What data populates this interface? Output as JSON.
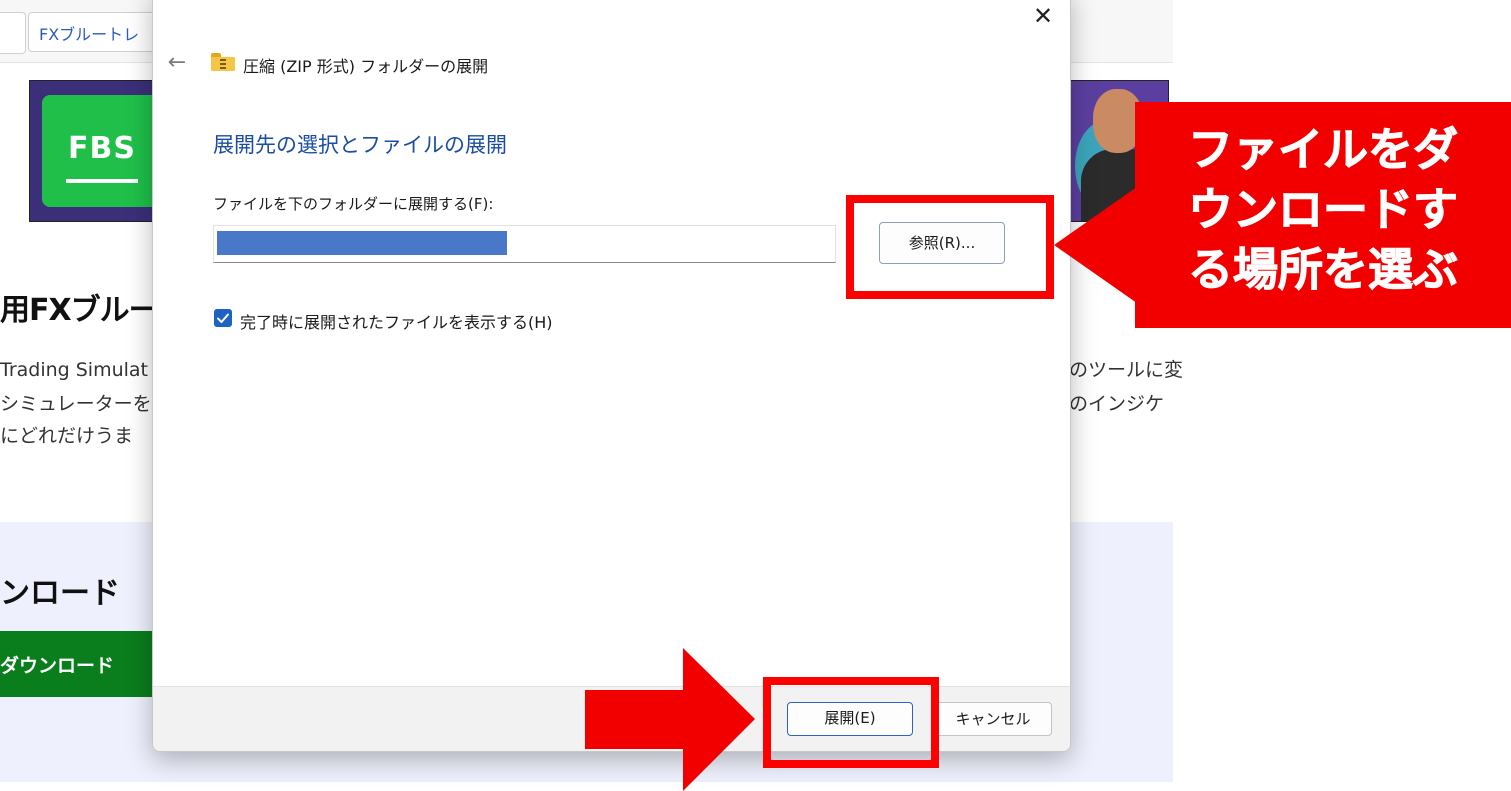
{
  "background_page": {
    "tab_title": "FXブルートレ",
    "banner_logo": "FBS",
    "heading": "用FXブルー",
    "text_lines_left": [
      "Trading Simulat",
      "シミュレーターを",
      "にどれだけうま"
    ],
    "text_lines_right": [
      "のツールに変",
      "のインジケ"
    ],
    "section_title": "ンロード",
    "download_button": "ダウンロード"
  },
  "dialog": {
    "title": "圧縮 (ZIP 形式) フォルダーの展開",
    "close_glyph": "✕",
    "back_glyph": "←",
    "heading": "展開先の選択とファイルの展開",
    "destination_label": "ファイルを下のフォルダーに展開する(F):",
    "path_value": "",
    "browse_button": "参照(R)...",
    "show_files_checkbox": {
      "label": "完了時に展開されたファイルを表示する(H)",
      "checked": true
    },
    "extract_button": "展開(E)",
    "cancel_button": "キャンセル"
  },
  "annotation": {
    "callout_lines": [
      "ファイルをダ",
      "ウンロードす",
      "る場所を選ぶ"
    ],
    "color": "#ff0000"
  },
  "colors": {
    "accent": "#1f63c2",
    "heading_blue": "#1b4ea3",
    "banner_green": "#1fbf4a",
    "download_green": "#0a7d1c"
  }
}
